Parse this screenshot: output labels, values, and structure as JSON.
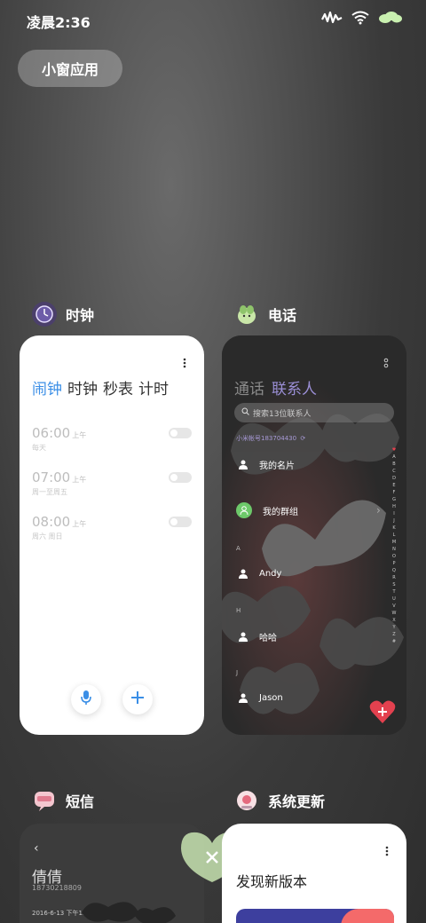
{
  "status_bar": {
    "time": "凌晨2:36",
    "icons": [
      "signal-waveform-icon",
      "wifi-icon",
      "battery-icon"
    ],
    "battery_color": "#c9f0b0"
  },
  "small_window": {
    "label": "小窗应用"
  },
  "apps": {
    "clock": {
      "title": "时钟",
      "tabs": [
        "闹钟",
        "时钟",
        "秒表",
        "计时"
      ],
      "active_tab": 0,
      "alarms": [
        {
          "time": "06:00",
          "ampm": "上午",
          "repeat": "每天",
          "enabled": false
        },
        {
          "time": "07:00",
          "ampm": "上午",
          "repeat": "周一至周五",
          "enabled": false
        },
        {
          "time": "08:00",
          "ampm": "上午",
          "repeat": "周六 周日",
          "enabled": false
        }
      ]
    },
    "phone": {
      "title": "电话",
      "tabs": [
        "通话",
        "联系人"
      ],
      "search_placeholder": "搜索13位联系人",
      "account": "小米帐号183704430",
      "contacts": {
        "my_card": "我的名片",
        "my_group": "我的群组",
        "letter_a": "A",
        "andy": "Andy",
        "letter_h": "H",
        "haha": "哈哈",
        "letter_j": "J",
        "jason": "Jason"
      },
      "index": [
        "♥",
        "A",
        "B",
        "C",
        "D",
        "E",
        "F",
        "G",
        "H",
        "I",
        "J",
        "K",
        "L",
        "M",
        "N",
        "O",
        "P",
        "Q",
        "R",
        "S",
        "T",
        "U",
        "V",
        "W",
        "X",
        "Y",
        "Z",
        "#"
      ],
      "accent": "#9b8fd6",
      "fab_color": "#e3414f"
    },
    "sms": {
      "title": "短信",
      "contact_name": "倩倩",
      "number": "18730218809",
      "timestamp": "2016-6-13 下午1:49"
    },
    "update": {
      "title": "系统更新",
      "heading": "发现新版本"
    }
  }
}
